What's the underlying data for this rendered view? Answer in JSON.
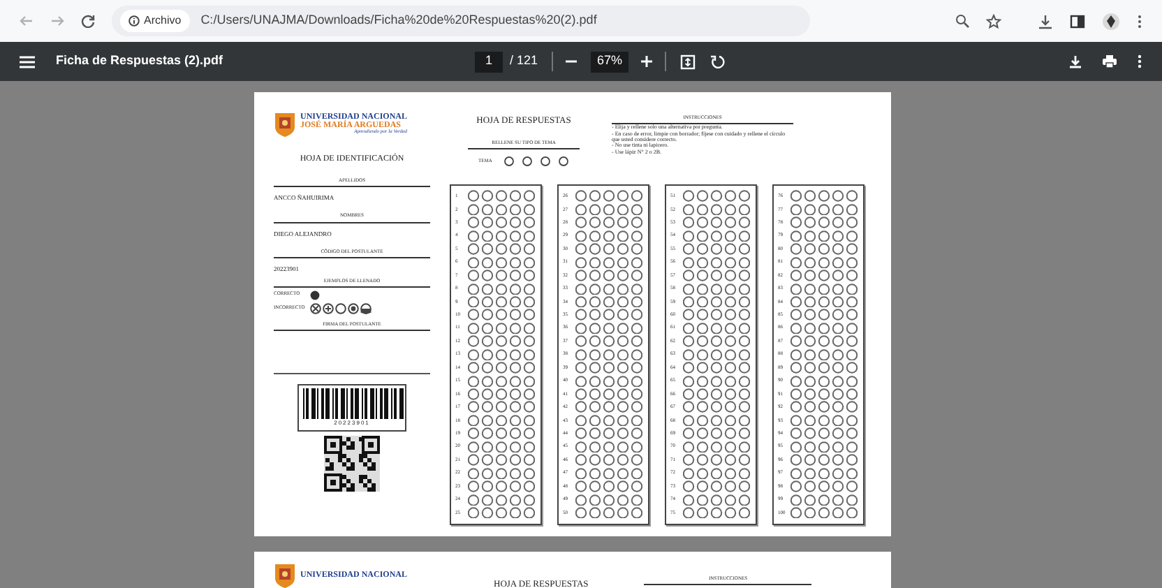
{
  "browser": {
    "address_chip": "Archivo",
    "url": "C:/Users/UNAJMA/Downloads/Ficha%20de%20Respuestas%20(2).pdf"
  },
  "viewer": {
    "title": "Ficha de Respuestas (2).pdf",
    "page": "1",
    "page_total": "/ 121",
    "zoom": "67%"
  },
  "sheet": {
    "university": {
      "name": "UNIVERSIDAD NACIONAL",
      "name_2": "JOSÉ MARÍA ARGUEDAS",
      "motto": "Aprendiendo por la Verdad"
    },
    "identification": {
      "title": "HOJA DE IDENTIFICACIÓN",
      "fields": [
        {
          "label": "APELLIDOS",
          "value": "ANCCO ÑAHUIRIMA"
        },
        {
          "label": "NOMBRES",
          "value": "DIEGO ALEJANDRO"
        },
        {
          "label": "CÓDIGO DEL POSTULANTE",
          "value": "20223901"
        }
      ],
      "examples_title": "EJEMPLOS DE LLENADO",
      "examples": [
        {
          "label": "CORRECTO",
          "kind": "correct"
        },
        {
          "label": "INCORRECTO",
          "kind": "incorrect"
        }
      ],
      "signature_label": "FIRMA DEL POSTULANTE",
      "barcode_number": "20223901"
    },
    "answers": {
      "title": "HOJA DE RESPUESTAS",
      "theme_prompt": "RELLENE SU TIPO DE TEMA",
      "theme_label": "TEMA",
      "instructions_title": "INSTRUCCIONES",
      "instructions": [
        "- Elija y rellene solo una alternativa por pregunta.",
        "- En caso de error, limpie con borrador; fíjese con cuidado y rellene el círculo que usted considere correcto.",
        "- No use tinta ni lapicero.",
        "- Use lápiz N° 2 o 2B."
      ],
      "columns": [
        [
          "1",
          "2",
          "3",
          "4",
          "5",
          "6",
          "7",
          "8",
          "9",
          "10",
          "11",
          "12",
          "13",
          "14",
          "15",
          "16",
          "17",
          "18",
          "19",
          "20",
          "21",
          "22",
          "23",
          "24",
          "25"
        ],
        [
          "26",
          "27",
          "28",
          "29",
          "30",
          "31",
          "32",
          "33",
          "34",
          "35",
          "36",
          "37",
          "38",
          "39",
          "40",
          "41",
          "42",
          "43",
          "44",
          "45",
          "46",
          "47",
          "48",
          "49",
          "50"
        ],
        [
          "51",
          "52",
          "53",
          "54",
          "55",
          "56",
          "57",
          "58",
          "59",
          "60",
          "61",
          "62",
          "63",
          "64",
          "65",
          "66",
          "67",
          "68",
          "69",
          "70",
          "71",
          "72",
          "73",
          "74",
          "75"
        ],
        [
          "76",
          "77",
          "78",
          "79",
          "80",
          "81",
          "82",
          "83",
          "84",
          "85",
          "86",
          "87",
          "88",
          "89",
          "90",
          "91",
          "92",
          "93",
          "94",
          "95",
          "96",
          "97",
          "98",
          "99",
          "100"
        ]
      ]
    }
  },
  "next_page": {
    "university_name": "UNIVERSIDAD NACIONAL",
    "title": "HOJA DE RESPUESTAS",
    "instructions_title": "INSTRUCCIONES"
  }
}
